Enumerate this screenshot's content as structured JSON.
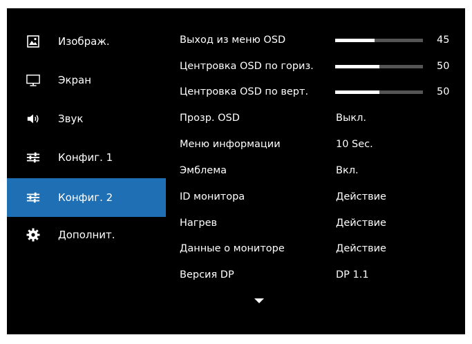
{
  "sidebar": {
    "items": [
      {
        "label": "Изображ.",
        "icon": "picture-icon"
      },
      {
        "label": "Экран",
        "icon": "monitor-icon"
      },
      {
        "label": "Звук",
        "icon": "speaker-icon"
      },
      {
        "label": "Конфиг. 1",
        "icon": "sliders-icon"
      },
      {
        "label": "Конфиг. 2",
        "icon": "sliders-icon",
        "selected": true
      },
      {
        "label": "Дополнит.",
        "icon": "gear-icon"
      }
    ]
  },
  "settings": {
    "rows": [
      {
        "label": "Выход из меню OSD",
        "slider_value": 45
      },
      {
        "label": "Центровка OSD по гориз.",
        "slider_value": 50
      },
      {
        "label": "Центровка OSD по верт.",
        "slider_value": 50
      },
      {
        "label": "Прозр. OSD",
        "value": "Выкл."
      },
      {
        "label": "Меню информации",
        "value": "10 Sec."
      },
      {
        "label": "Эмблема",
        "value": "Вкл."
      },
      {
        "label": "ID монитора",
        "value": "Действие"
      },
      {
        "label": "Нагрев",
        "value": "Действие"
      },
      {
        "label": "Данные о мониторе",
        "value": "Действие"
      },
      {
        "label": "Версия DP",
        "value": "DP 1.1"
      }
    ],
    "scroll_icon": "chevron-down-icon"
  },
  "colors": {
    "background": "#000000",
    "selection": "#1f6fb5",
    "text": "#ffffff",
    "slider_track": "#555555"
  }
}
